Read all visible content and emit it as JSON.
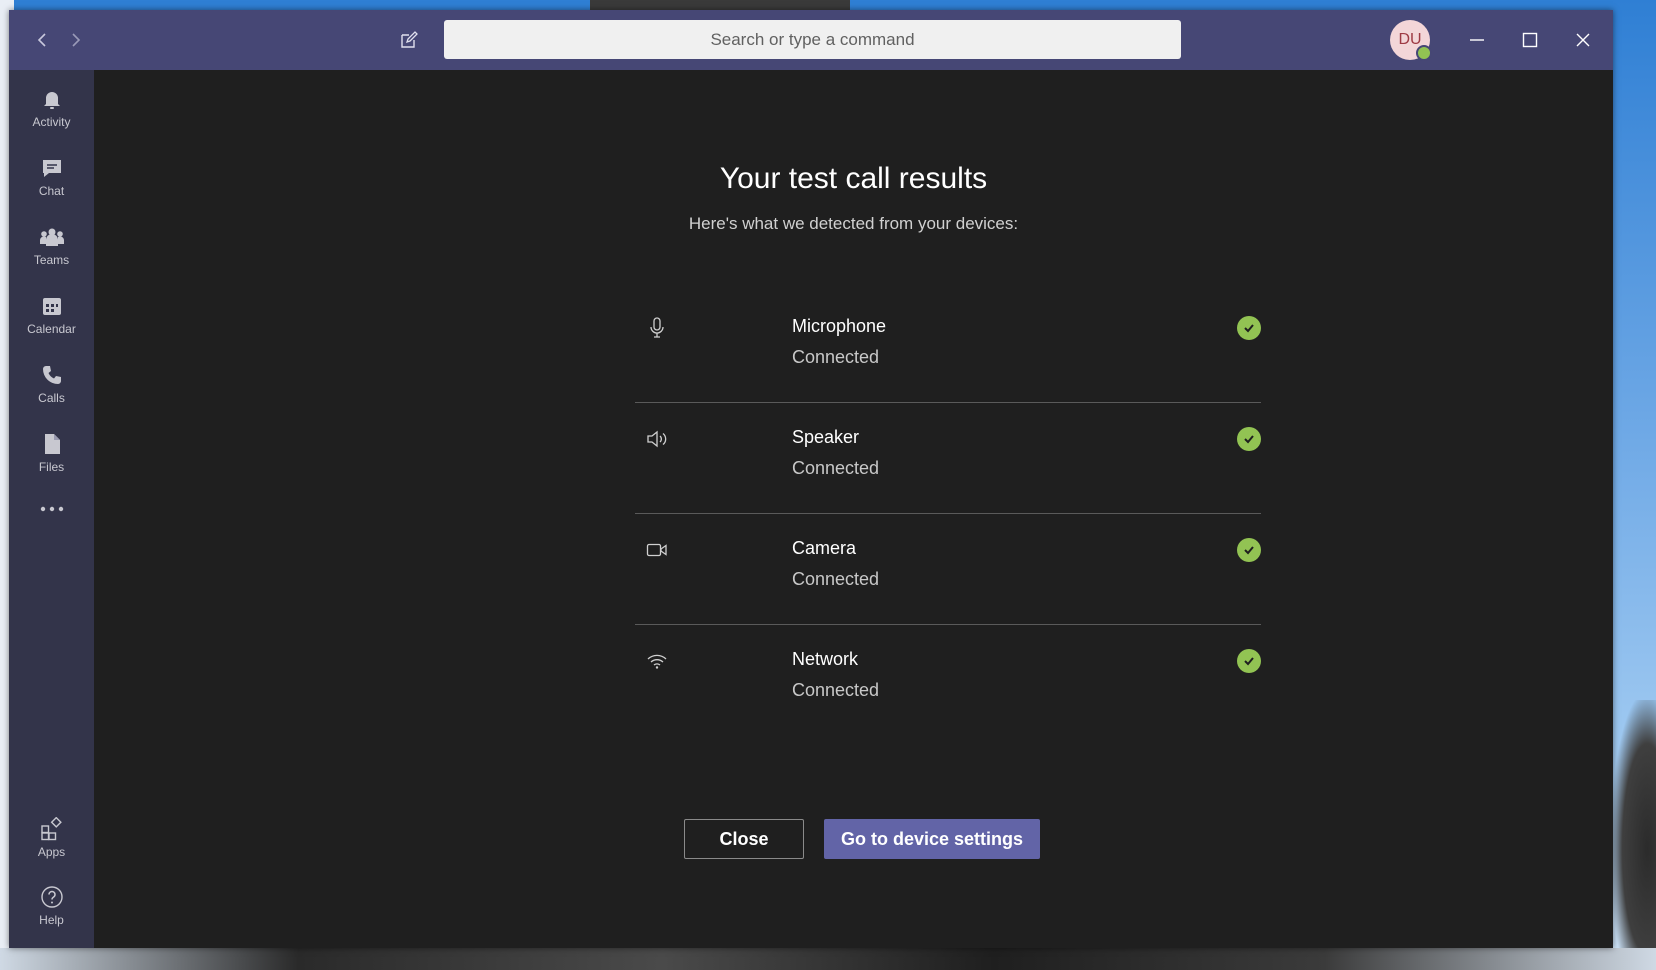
{
  "window": {
    "search_placeholder": "Search or type a command",
    "avatar_initials": "DU",
    "presence_status": "available",
    "colors": {
      "titlebar": "#464775",
      "rail": "#33344a",
      "main_bg": "#1f1f1f",
      "accent": "#6264a7",
      "success": "#92c353"
    }
  },
  "rail": {
    "items": [
      {
        "label": "Activity",
        "icon": "bell-icon"
      },
      {
        "label": "Chat",
        "icon": "chat-icon"
      },
      {
        "label": "Teams",
        "icon": "teams-icon"
      },
      {
        "label": "Calendar",
        "icon": "calendar-icon"
      },
      {
        "label": "Calls",
        "icon": "phone-icon"
      },
      {
        "label": "Files",
        "icon": "file-icon"
      }
    ],
    "bottom": [
      {
        "label": "Apps",
        "icon": "apps-icon"
      },
      {
        "label": "Help",
        "icon": "help-icon"
      }
    ]
  },
  "results": {
    "title": "Your test call results",
    "subtitle": "Here's what we detected from your devices:",
    "devices": [
      {
        "name": "Microphone",
        "status": "Connected",
        "icon": "microphone-icon"
      },
      {
        "name": "Speaker",
        "status": "Connected",
        "icon": "speaker-icon"
      },
      {
        "name": "Camera",
        "status": "Connected",
        "icon": "camera-icon"
      },
      {
        "name": "Network",
        "status": "Connected",
        "icon": "wifi-icon"
      }
    ],
    "close_label": "Close",
    "settings_label": "Go to device settings"
  }
}
